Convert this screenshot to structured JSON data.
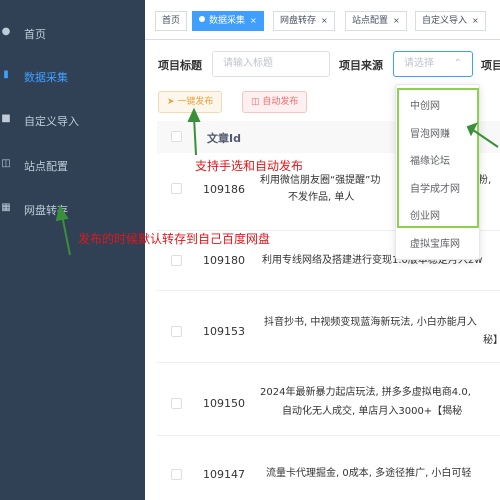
{
  "sidebar": {
    "items": [
      {
        "label": "首页",
        "icon": "dashboard-icon"
      },
      {
        "label": "数据采集",
        "icon": "bar-chart-icon"
      },
      {
        "label": "自定义导入",
        "icon": "import-icon"
      },
      {
        "label": "站点配置",
        "icon": "monitor-icon"
      },
      {
        "label": "网盘转存",
        "icon": "transfer-icon"
      }
    ]
  },
  "tabs": [
    {
      "label": "首页"
    },
    {
      "label": "数据采集"
    },
    {
      "label": "网盘转存"
    },
    {
      "label": "站点配置"
    },
    {
      "label": "自定义导入"
    }
  ],
  "search": {
    "title_label": "项目标题",
    "title_placeholder": "请输入标题",
    "source_label": "项目来源",
    "source_placeholder": "请选择",
    "extra_label": "项目"
  },
  "toolbar": {
    "publish_label": "一键发布",
    "auto_label": "自动发布"
  },
  "table": {
    "id_header": "文章Id",
    "rows": [
      {
        "id": "109186",
        "line1": "利用微信朋友圈“强提醒”功",
        "line1b": "粉,",
        "line2": "不发作品, 单人"
      },
      {
        "id": "109180",
        "line1": "利用专线网络及搭建进行变现1.0版本稳定月入2w",
        "line2": ""
      },
      {
        "id": "109153",
        "line1": "抖音抄书, 中视频变现蓝海新玩法, 小白亦能月入",
        "line2": "秘】"
      },
      {
        "id": "109150",
        "line1": "2024年最新暴力起店玩法, 拼多多虚拟电商4.0,",
        "line2": "自动化无人成交, 单店月入3000+【揭秘"
      },
      {
        "id": "109147",
        "line1": "流量卡代理掘金, 0成本, 多途径推广, 小白可轻",
        "line2": ""
      }
    ]
  },
  "dropdown": {
    "options": [
      "中创网",
      "冒泡网赚",
      "福缘论坛",
      "自学成才网",
      "创业网",
      "虚拟宝库网"
    ]
  },
  "annotations": {
    "publish_note": "支持手选和自动发布",
    "transfer_note": "发布的时候默认转存到自己百度网盘"
  },
  "colors": {
    "sidebar_bg": "#304156",
    "accent": "#409eff",
    "annotation_red": "#e0161b",
    "arrow_green": "#3a8f3a",
    "highlight_green": "#8fd14f"
  }
}
